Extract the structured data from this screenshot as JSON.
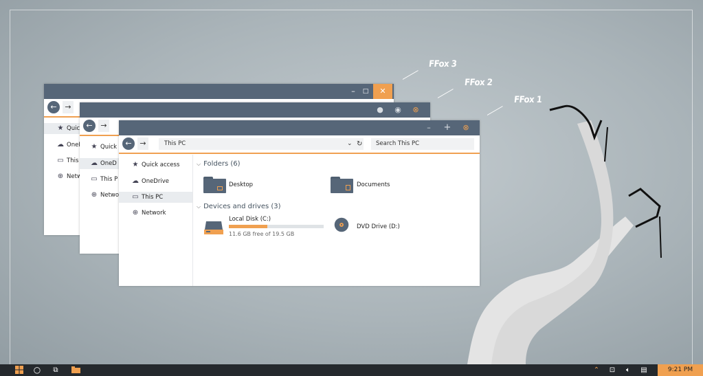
{
  "skins": {
    "ffox3": "FFox 3",
    "ffox2": "FFox 2",
    "ffox1": "FFox 1"
  },
  "window3": {
    "controls": {
      "minimize": "–",
      "maximize": "□",
      "close": "✕"
    },
    "nav": [
      {
        "icon": "★",
        "label": "Quick access",
        "short": "Quick"
      },
      {
        "icon": "☁",
        "label": "OneDrive",
        "short": "OneI"
      },
      {
        "icon": "▭",
        "label": "This PC",
        "short": "This"
      },
      {
        "icon": "⊕",
        "label": "Network",
        "short": "Netw"
      }
    ]
  },
  "window2": {
    "controls": {
      "minimize": "●",
      "maximize": "◉",
      "close": "⊗"
    },
    "nav": [
      {
        "icon": "★",
        "label": "Quick access",
        "short": "Quick"
      },
      {
        "icon": "☁",
        "label": "OneDrive",
        "short": "OneD"
      },
      {
        "icon": "▭",
        "label": "This PC",
        "short": "This P"
      },
      {
        "icon": "⊕",
        "label": "Network",
        "short": "Netwo"
      }
    ]
  },
  "window1": {
    "controls": {
      "minimize": "–",
      "maximize": "+",
      "close": "⊗"
    },
    "address": "This PC",
    "search_placeholder": "Search This PC",
    "nav": [
      {
        "icon": "★",
        "label": "Quick access"
      },
      {
        "icon": "☁",
        "label": "OneDrive"
      },
      {
        "icon": "▭",
        "label": "This PC"
      },
      {
        "icon": "⊕",
        "label": "Network"
      }
    ],
    "folders_header": "Folders (6)",
    "folders": [
      {
        "name": "Desktop"
      },
      {
        "name": "Documents"
      }
    ],
    "drives_header": "Devices and drives (3)",
    "drives": [
      {
        "name": "Local Disk (C:)",
        "free": "11.6 GB free of 19.5 GB",
        "used_fraction": 0.405
      },
      {
        "name": "DVD Drive (D:)"
      }
    ]
  },
  "taskbar": {
    "clock": "9:21 PM"
  },
  "colors": {
    "accent": "#f0a050",
    "titlebar": "#566678",
    "taskbar": "#25292d"
  }
}
